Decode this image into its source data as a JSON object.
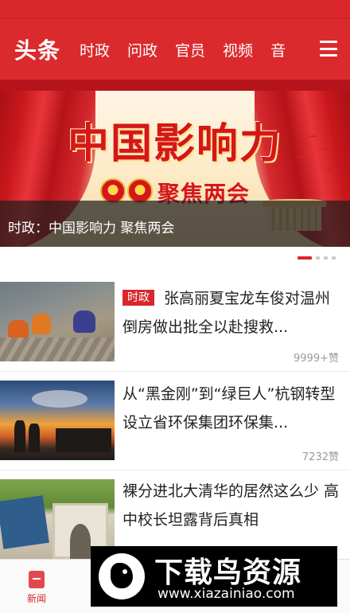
{
  "header": {
    "home_tab": "头条",
    "tabs": [
      "时政",
      "问政",
      "官员",
      "视频",
      "音"
    ],
    "menu_icon": "hamburger-menu-icon",
    "background": "#db2a2d"
  },
  "banner": {
    "title": "中国影响力",
    "subtitle": "聚焦两会",
    "caption": "时政：中国影响力 聚焦两会",
    "slide_index": 1,
    "slide_count": 4
  },
  "news": [
    {
      "tag": "时政",
      "title": "张高丽夏宝龙车俊对温州倒房做出批全以赴搜救...",
      "likes": "9999+赞",
      "thumb": "rescue-scene-image"
    },
    {
      "title": "从“黑金刚”到“绿巨人”杭钢转型设立省环保集团环保集...",
      "likes": "7232赞",
      "thumb": "steel-plant-sunset-image"
    },
    {
      "title": "裸分进北大清华的居然这么少 高中校长坦露背后真相",
      "thumb": "school-gate-image"
    }
  ],
  "bottom_nav": {
    "news_label": "新闻",
    "news_icon": "news-icon"
  },
  "watermark": {
    "text": "下载鸟资源",
    "url": "www.xiazainiao.com"
  },
  "colors": {
    "accent": "#d9272b",
    "likes_text": "#9a9a9a"
  }
}
